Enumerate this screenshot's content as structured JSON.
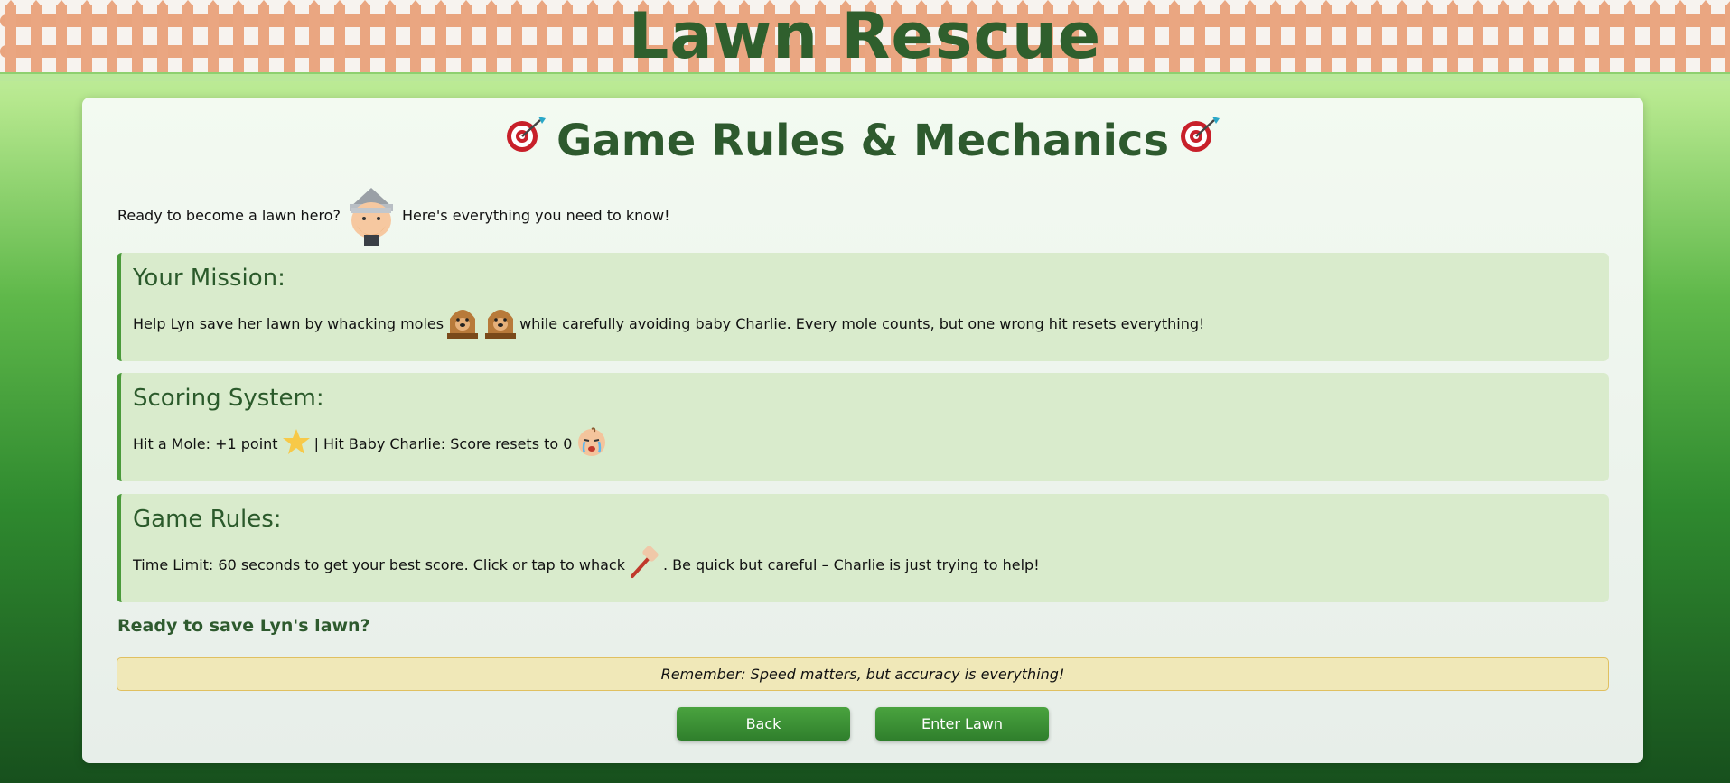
{
  "app": {
    "title": "Lawn Rescue"
  },
  "card": {
    "heading": "Game Rules & Mechanics",
    "intro_before": "Ready to become a lawn hero?",
    "intro_after": "Here's everything you need to know!"
  },
  "sections": {
    "mission": {
      "title": "Your Mission:",
      "text_before": "Help Lyn save her lawn by whacking moles",
      "text_after": "while carefully avoiding baby Charlie. Every mole counts, but one wrong hit resets everything!"
    },
    "scoring": {
      "title": "Scoring System:",
      "text_before": "Hit a Mole: +1 point",
      "text_middle": "| Hit Baby Charlie: Score resets to 0"
    },
    "rules": {
      "title": "Game Rules:",
      "text_before": "Time Limit: 60 seconds to get your best score. Click or tap to whack",
      "text_after": ". Be quick but careful – Charlie is just trying to help!"
    }
  },
  "ready_text": "Ready to save Lyn's lawn?",
  "reminder": "Remember: Speed matters, but accuracy is everything!",
  "buttons": {
    "back": "Back",
    "enter": "Enter Lawn"
  },
  "icons": [
    "target-icon",
    "lyn-avatar-icon",
    "mole-icon",
    "star-icon",
    "crying-baby-icon",
    "mallet-icon"
  ],
  "colors": {
    "accent_green": "#2e5a2e",
    "section_bg": "#d9ebcc",
    "section_border": "#4a9a3a",
    "fence": "#eaa681",
    "button": "#3a8f35",
    "reminder_bg": "#f0e8b8"
  }
}
